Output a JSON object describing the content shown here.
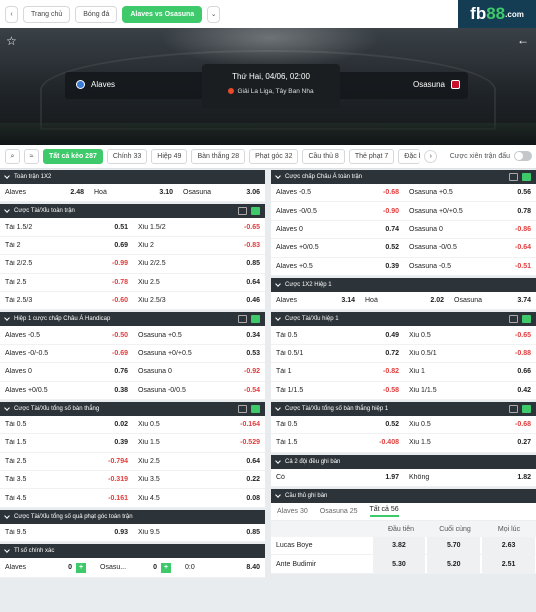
{
  "nav": {
    "home": "Trang chủ",
    "football": "Bóng đá",
    "match": "Alaves vs Osasuna",
    "chevron": "⌄"
  },
  "logo": {
    "text_a": "fb",
    "text_b": "88",
    "text_c": ".com"
  },
  "match": {
    "home": "Alaves",
    "away": "Osasuna",
    "datetime": "Thứ Hai, 04/06, 02:00",
    "league": "Giải La Liga, Tây Ban Nha"
  },
  "tabs": {
    "items": [
      "Tất cả kèo 287",
      "Chính 33",
      "Hiệp 49",
      "Bàn thắng 28",
      "Phạt góc 32",
      "Cầu thủ 8",
      "Thẻ phạt 7",
      "Đặc b"
    ],
    "parlay_label": "Cược xiên trận đấu"
  },
  "left": {
    "s1": {
      "title": "Toàn trận 1X2",
      "rows": [
        [
          "Alaves",
          "2.48",
          "Hoà",
          "3.10",
          "Osasuna",
          "3.06"
        ]
      ]
    },
    "s2": {
      "title": "Cược Tài/Xỉu toàn trận",
      "rows": [
        [
          "Tài 1.5/2",
          "0.51",
          "Xỉu 1.5/2",
          "-0.65"
        ],
        [
          "Tài 2",
          "0.69",
          "Xỉu 2",
          "-0.83"
        ],
        [
          "Tài 2/2.5",
          "-0.99",
          "Xỉu 2/2.5",
          "0.85"
        ],
        [
          "Tài 2.5",
          "-0.78",
          "Xỉu 2.5",
          "0.64"
        ],
        [
          "Tài 2.5/3",
          "-0.60",
          "Xỉu 2.5/3",
          "0.46"
        ]
      ]
    },
    "s3": {
      "title": "Hiệp 1 cược chấp Châu Á Handicap",
      "rows": [
        [
          "Alaves -0.5",
          "-0.50",
          "Osasuna +0.5",
          "0.34"
        ],
        [
          "Alaves -0/-0.5",
          "-0.69",
          "Osasuna +0/+0.5",
          "0.53"
        ],
        [
          "Alaves 0",
          "0.76",
          "Osasuna 0",
          "-0.92"
        ],
        [
          "Alaves +0/0.5",
          "0.38",
          "Osasuna -0/0.5",
          "-0.54"
        ]
      ]
    },
    "s4": {
      "title": "Cược Tài/Xỉu tổng số bàn thắng",
      "rows": [
        [
          "Tài 0.5",
          "0.02",
          "Xỉu 0.5",
          "-0.164"
        ],
        [
          "Tài 1.5",
          "0.39",
          "Xỉu 1.5",
          "-0.529"
        ],
        [
          "Tài 2.5",
          "-0.794",
          "Xỉu 2.5",
          "0.64"
        ],
        [
          "Tài 3.5",
          "-0.319",
          "Xỉu 3.5",
          "0.22"
        ],
        [
          "Tài 4.5",
          "-0.161",
          "Xỉu 4.5",
          "0.08"
        ]
      ]
    },
    "s5": {
      "title": "Cược Tài/Xỉu tổng số quả phạt góc toàn trận",
      "rows": [
        [
          "Tài 9.5",
          "0.93",
          "Xỉu 9.5",
          "0.85"
        ]
      ]
    },
    "s6": {
      "title": "Tỉ số chính xác",
      "home": "Alaves",
      "home_score": "0",
      "away": "Osasu...",
      "away_score": "0",
      "plus": "+",
      "result": "0:0",
      "odds": "8.40"
    }
  },
  "right": {
    "r1": {
      "title": "Cược chấp Châu Á toàn trận",
      "rows": [
        [
          "Alaves -0.5",
          "-0.68",
          "Osasuna +0.5",
          "0.56"
        ],
        [
          "Alaves -0/0.5",
          "-0.90",
          "Osasuna +0/+0.5",
          "0.78"
        ],
        [
          "Alaves 0",
          "0.74",
          "Osasuna 0",
          "-0.86"
        ],
        [
          "Alaves +0/0.5",
          "0.52",
          "Osasuna -0/0.5",
          "-0.64"
        ],
        [
          "Alaves +0.5",
          "0.39",
          "Osasuna -0.5",
          "-0.51"
        ]
      ]
    },
    "r2": {
      "title": "Cược 1X2 Hiệp 1",
      "rows": [
        [
          "Alaves",
          "3.14",
          "Hoà",
          "2.02",
          "Osasuna",
          "3.74"
        ]
      ]
    },
    "r3": {
      "title": "Cược Tài/Xỉu hiệp 1",
      "rows": [
        [
          "Tài 0.5",
          "0.49",
          "Xỉu 0.5",
          "-0.65"
        ],
        [
          "Tài 0.5/1",
          "0.72",
          "Xỉu 0.5/1",
          "-0.88"
        ],
        [
          "Tài 1",
          "-0.82",
          "Xỉu 1",
          "0.66"
        ],
        [
          "Tài 1/1.5",
          "-0.58",
          "Xỉu 1/1.5",
          "0.42"
        ]
      ]
    },
    "r4": {
      "title": "Cược Tài/Xỉu tổng số bàn thắng hiệp 1",
      "rows": [
        [
          "Tài 0.5",
          "0.52",
          "Xỉu 0.5",
          "-0.68"
        ],
        [
          "Tài 1.5",
          "-0.408",
          "Xỉu 1.5",
          "0.27"
        ]
      ]
    },
    "r5": {
      "title": "Cả 2 đội đều ghi bàn",
      "rows": [
        [
          "Có",
          "1.97",
          "Không",
          "1.82"
        ]
      ]
    },
    "r6": {
      "title": "Cầu thủ ghi bàn",
      "subtabs": [
        "Alaves 30",
        "Osasuna 25",
        "Tất cả 56"
      ],
      "headers": [
        "Đầu tiên",
        "Cuối cùng",
        "Mọi lúc"
      ],
      "players": [
        [
          "Lucas Boye",
          "3.82",
          "5.70",
          "2.63"
        ],
        [
          "Ante Budimir",
          "5.30",
          "5.20",
          "2.51"
        ]
      ]
    }
  },
  "colors": {
    "accent": "#3ec96b",
    "header_bg": "#2d3439",
    "negative": "#e23c3c"
  }
}
